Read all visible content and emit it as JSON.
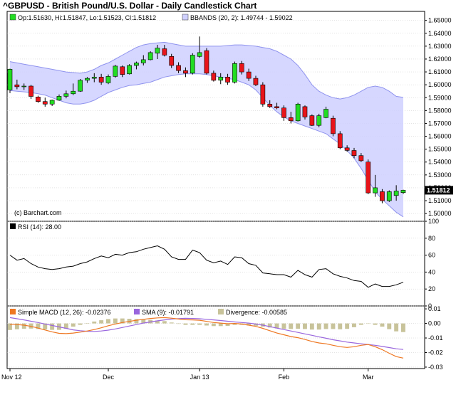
{
  "title": "^GBPUSD - British Pound/U.S. Dollar - Daily Candlestick Chart",
  "colors": {
    "up": "#22dd22",
    "down": "#e8141a",
    "band_fill": "#cfd0ff",
    "band_line": "#8f93ee",
    "rsi_line": "#000000",
    "macd_line": "#ee7722",
    "sma_line": "#9966dd",
    "divergence": "#c8c39a",
    "price_box": "#000000"
  },
  "chart_data": [
    {
      "type": "candlestick",
      "legend": [
        {
          "text": "Op:1.51630, Hi:1.51847, Lo:1.51523, Cl:1.51812",
          "color": "#22dd22"
        },
        {
          "text": "BBANDS (20, 2): 1.49744 - 1.59022",
          "color": "#cfd0ff"
        }
      ],
      "credit": "(c) Barchart.com",
      "last_price_label": "1.51812",
      "ylim": [
        1.494,
        1.657
      ],
      "yticks": [
        1.5,
        1.51,
        1.52,
        1.53,
        1.54,
        1.55,
        1.56,
        1.57,
        1.58,
        1.59,
        1.6,
        1.61,
        1.62,
        1.63,
        1.64,
        1.65
      ],
      "ytick_labels": [
        "1.50000",
        "1.51000",
        "1.52000",
        "1.53000",
        "1.54000",
        "1.55000",
        "1.56000",
        "1.57000",
        "1.58000",
        "1.59000",
        "1.60000",
        "1.61000",
        "1.62000",
        "1.63000",
        "1.64000",
        "1.65000"
      ],
      "x_labels": [
        {
          "text": "Nov 12",
          "index": 0
        },
        {
          "text": "Dec",
          "index": 14
        },
        {
          "text": "Jan 13",
          "index": 27
        },
        {
          "text": "Feb",
          "index": 39
        },
        {
          "text": "Mar",
          "index": 51
        }
      ],
      "candles": [
        {
          "o": 1.596,
          "h": 1.6125,
          "l": 1.5935,
          "c": 1.612
        },
        {
          "o": 1.6,
          "h": 1.604,
          "l": 1.5965,
          "c": 1.5985
        },
        {
          "o": 1.5985,
          "h": 1.601,
          "l": 1.596,
          "c": 1.599
        },
        {
          "o": 1.599,
          "h": 1.6,
          "l": 1.589,
          "c": 1.591
        },
        {
          "o": 1.5905,
          "h": 1.5915,
          "l": 1.586,
          "c": 1.587
        },
        {
          "o": 1.587,
          "h": 1.59,
          "l": 1.583,
          "c": 1.585
        },
        {
          "o": 1.585,
          "h": 1.5885,
          "l": 1.5835,
          "c": 1.588
        },
        {
          "o": 1.588,
          "h": 1.5925,
          "l": 1.5875,
          "c": 1.591
        },
        {
          "o": 1.591,
          "h": 1.5955,
          "l": 1.5895,
          "c": 1.593
        },
        {
          "o": 1.593,
          "h": 1.601,
          "l": 1.592,
          "c": 1.595
        },
        {
          "o": 1.595,
          "h": 1.6045,
          "l": 1.5945,
          "c": 1.6035
        },
        {
          "o": 1.6035,
          "h": 1.606,
          "l": 1.6015,
          "c": 1.605
        },
        {
          "o": 1.605,
          "h": 1.609,
          "l": 1.602,
          "c": 1.606
        },
        {
          "o": 1.606,
          "h": 1.6085,
          "l": 1.6,
          "c": 1.602
        },
        {
          "o": 1.6015,
          "h": 1.608,
          "l": 1.6005,
          "c": 1.6065
        },
        {
          "o": 1.6065,
          "h": 1.6155,
          "l": 1.6055,
          "c": 1.6145
        },
        {
          "o": 1.614,
          "h": 1.615,
          "l": 1.606,
          "c": 1.608
        },
        {
          "o": 1.6085,
          "h": 1.616,
          "l": 1.608,
          "c": 1.615
        },
        {
          "o": 1.615,
          "h": 1.618,
          "l": 1.612,
          "c": 1.617
        },
        {
          "o": 1.617,
          "h": 1.623,
          "l": 1.615,
          "c": 1.6195
        },
        {
          "o": 1.6195,
          "h": 1.626,
          "l": 1.619,
          "c": 1.625
        },
        {
          "o": 1.6245,
          "h": 1.631,
          "l": 1.62,
          "c": 1.6285
        },
        {
          "o": 1.628,
          "h": 1.631,
          "l": 1.622,
          "c": 1.623
        },
        {
          "o": 1.622,
          "h": 1.624,
          "l": 1.613,
          "c": 1.615
        },
        {
          "o": 1.615,
          "h": 1.6175,
          "l": 1.609,
          "c": 1.611
        },
        {
          "o": 1.611,
          "h": 1.6135,
          "l": 1.606,
          "c": 1.609
        },
        {
          "o": 1.609,
          "h": 1.6245,
          "l": 1.608,
          "c": 1.623
        },
        {
          "o": 1.622,
          "h": 1.6375,
          "l": 1.621,
          "c": 1.625
        },
        {
          "o": 1.6265,
          "h": 1.6285,
          "l": 1.608,
          "c": 1.609
        },
        {
          "o": 1.609,
          "h": 1.611,
          "l": 1.6025,
          "c": 1.6035
        },
        {
          "o": 1.6035,
          "h": 1.609,
          "l": 1.6005,
          "c": 1.606
        },
        {
          "o": 1.606,
          "h": 1.6085,
          "l": 1.6,
          "c": 1.602
        },
        {
          "o": 1.602,
          "h": 1.618,
          "l": 1.601,
          "c": 1.6165
        },
        {
          "o": 1.6165,
          "h": 1.6185,
          "l": 1.608,
          "c": 1.61
        },
        {
          "o": 1.61,
          "h": 1.6125,
          "l": 1.603,
          "c": 1.605
        },
        {
          "o": 1.605,
          "h": 1.607,
          "l": 1.599,
          "c": 1.6
        },
        {
          "o": 1.6,
          "h": 1.602,
          "l": 1.583,
          "c": 1.585
        },
        {
          "o": 1.585,
          "h": 1.588,
          "l": 1.582,
          "c": 1.583
        },
        {
          "o": 1.583,
          "h": 1.586,
          "l": 1.581,
          "c": 1.582
        },
        {
          "o": 1.582,
          "h": 1.584,
          "l": 1.572,
          "c": 1.5745
        },
        {
          "o": 1.5745,
          "h": 1.579,
          "l": 1.57,
          "c": 1.572
        },
        {
          "o": 1.572,
          "h": 1.586,
          "l": 1.5715,
          "c": 1.585
        },
        {
          "o": 1.583,
          "h": 1.584,
          "l": 1.573,
          "c": 1.575
        },
        {
          "o": 1.576,
          "h": 1.577,
          "l": 1.568,
          "c": 1.5685
        },
        {
          "o": 1.5685,
          "h": 1.5775,
          "l": 1.567,
          "c": 1.576
        },
        {
          "o": 1.5745,
          "h": 1.583,
          "l": 1.574,
          "c": 1.581
        },
        {
          "o": 1.574,
          "h": 1.576,
          "l": 1.56,
          "c": 1.562
        },
        {
          "o": 1.562,
          "h": 1.564,
          "l": 1.55,
          "c": 1.551
        },
        {
          "o": 1.551,
          "h": 1.553,
          "l": 1.548,
          "c": 1.549
        },
        {
          "o": 1.549,
          "h": 1.551,
          "l": 1.543,
          "c": 1.545
        },
        {
          "o": 1.545,
          "h": 1.547,
          "l": 1.54,
          "c": 1.541
        },
        {
          "o": 1.54,
          "h": 1.542,
          "l": 1.515,
          "c": 1.516
        },
        {
          "o": 1.516,
          "h": 1.53,
          "l": 1.513,
          "c": 1.52
        },
        {
          "o": 1.517,
          "h": 1.519,
          "l": 1.508,
          "c": 1.51
        },
        {
          "o": 1.51,
          "h": 1.518,
          "l": 1.509,
          "c": 1.517
        },
        {
          "o": 1.514,
          "h": 1.522,
          "l": 1.51,
          "c": 1.5175
        },
        {
          "o": 1.5163,
          "h": 1.5185,
          "l": 1.5152,
          "c": 1.5181
        }
      ],
      "bband_upper": [
        1.618,
        1.617,
        1.616,
        1.615,
        1.614,
        1.613,
        1.612,
        1.611,
        1.61,
        1.6095,
        1.609,
        1.61,
        1.612,
        1.615,
        1.617,
        1.62,
        1.623,
        1.626,
        1.629,
        1.631,
        1.632,
        1.6325,
        1.633,
        1.632,
        1.631,
        1.63,
        1.63,
        1.63,
        1.63,
        1.63,
        1.63,
        1.6305,
        1.631,
        1.631,
        1.6305,
        1.63,
        1.629,
        1.628,
        1.626,
        1.623,
        1.62,
        1.615,
        1.608,
        1.6,
        1.595,
        1.592,
        1.59,
        1.589,
        1.59,
        1.592,
        1.595,
        1.598,
        1.599,
        1.598,
        1.595,
        1.591,
        1.5902
      ],
      "bband_lower": [
        1.5955,
        1.595,
        1.5945,
        1.594,
        1.593,
        1.592,
        1.59,
        1.588,
        1.586,
        1.585,
        1.585,
        1.586,
        1.588,
        1.591,
        1.594,
        1.596,
        1.598,
        1.5995,
        1.6,
        1.601,
        1.602,
        1.604,
        1.606,
        1.607,
        1.608,
        1.6085,
        1.6085,
        1.6085,
        1.608,
        1.607,
        1.606,
        1.605,
        1.604,
        1.602,
        1.6,
        1.596,
        1.59,
        1.584,
        1.579,
        1.575,
        1.572,
        1.57,
        1.568,
        1.566,
        1.564,
        1.562,
        1.558,
        1.554,
        1.549,
        1.543,
        1.535,
        1.526,
        1.517,
        1.511,
        1.506,
        1.501,
        1.4974
      ]
    },
    {
      "type": "line",
      "legend": [
        {
          "text": "RSI (14): 28.00",
          "color": "#000000"
        }
      ],
      "ylim": [
        0,
        100
      ],
      "yticks": [
        0,
        20,
        40,
        60,
        80,
        100
      ],
      "ytick_labels": [
        "0",
        "20",
        "40",
        "60",
        "80",
        "100"
      ],
      "series": [
        {
          "name": "RSI (14)",
          "values": [
            60,
            54,
            56,
            50,
            46,
            44,
            43,
            44,
            46,
            47,
            50,
            52,
            56,
            59,
            57,
            61,
            60,
            63,
            64,
            67,
            69,
            71,
            67,
            58,
            55,
            55,
            66,
            63,
            54,
            51,
            53,
            49,
            58,
            57,
            50,
            48,
            39,
            38,
            37,
            37,
            34,
            42,
            37,
            34,
            43,
            44,
            38,
            35,
            33,
            30,
            29,
            22,
            26,
            23,
            23,
            25,
            28
          ]
        }
      ]
    },
    {
      "type": "bar",
      "legend": [
        {
          "text": "Simple MACD (12, 26): -0.02376",
          "color": "#ee7722"
        },
        {
          "text": "SMA (9): -0.01791",
          "color": "#9966dd"
        },
        {
          "text": "Divergence: -0.00585",
          "color": "#c8c39a"
        }
      ],
      "ylim": [
        -0.031,
        0.012
      ],
      "yticks": [
        -0.03,
        -0.02,
        -0.01,
        0.0,
        0.01
      ],
      "ytick_labels": [
        "-0.03",
        "-0.02",
        "-0.01",
        "0.00",
        "0.01"
      ],
      "series": [
        {
          "name": "Simple MACD (12, 26)",
          "values": [
            -0.0005,
            -0.0008,
            -0.0012,
            -0.002,
            -0.0032,
            -0.0045,
            -0.0058,
            -0.0068,
            -0.007,
            -0.0066,
            -0.006,
            -0.0052,
            -0.0042,
            -0.003,
            -0.0016,
            -0.0004,
            0.0006,
            0.0014,
            0.0022,
            0.0028,
            0.0034,
            0.0038,
            0.004,
            0.0036,
            0.003,
            0.0025,
            0.0024,
            0.0022,
            0.0014,
            0.0006,
            0.0002,
            -0.0002,
            0.0,
            -0.0004,
            -0.0012,
            -0.002,
            -0.0034,
            -0.005,
            -0.0066,
            -0.0078,
            -0.009,
            -0.0098,
            -0.011,
            -0.0124,
            -0.0134,
            -0.014,
            -0.015,
            -0.016,
            -0.0165,
            -0.016,
            -0.015,
            -0.0145,
            -0.016,
            -0.018,
            -0.0205,
            -0.0228,
            -0.0238
          ]
        },
        {
          "name": "SMA (9)",
          "values": [
            0.004,
            0.0032,
            0.0024,
            0.0015,
            0.0006,
            -0.0004,
            -0.0014,
            -0.0024,
            -0.0034,
            -0.0044,
            -0.005,
            -0.0054,
            -0.0055,
            -0.0052,
            -0.0046,
            -0.0038,
            -0.0028,
            -0.0018,
            -0.0008,
            0.0002,
            0.001,
            0.0018,
            0.0024,
            0.003,
            0.0033,
            0.0035,
            0.0034,
            0.0032,
            0.0028,
            0.0024,
            0.002,
            0.0015,
            0.001,
            0.0006,
            0.0002,
            -0.0004,
            -0.0012,
            -0.0022,
            -0.0032,
            -0.0042,
            -0.0052,
            -0.0062,
            -0.0072,
            -0.0082,
            -0.0092,
            -0.0102,
            -0.0112,
            -0.012,
            -0.0128,
            -0.0134,
            -0.014,
            -0.0145,
            -0.015,
            -0.0158,
            -0.0166,
            -0.0174,
            -0.0179
          ]
        },
        {
          "name": "Divergence",
          "values": [
            -0.0045,
            -0.004,
            -0.0036,
            -0.0035,
            -0.0038,
            -0.0041,
            -0.0044,
            -0.0044,
            -0.0036,
            -0.0022,
            -0.001,
            0.0002,
            0.0013,
            0.0022,
            0.003,
            0.0034,
            0.0034,
            0.0032,
            0.003,
            0.0026,
            0.0024,
            0.002,
            0.0016,
            0.0006,
            -0.0003,
            -0.001,
            -0.001,
            -0.001,
            -0.0014,
            -0.0018,
            -0.0018,
            -0.0017,
            -0.001,
            -0.001,
            -0.0014,
            -0.0016,
            -0.0022,
            -0.0028,
            -0.0034,
            -0.0036,
            -0.0038,
            -0.0036,
            -0.0038,
            -0.0042,
            -0.0042,
            -0.0038,
            -0.0038,
            -0.004,
            -0.0037,
            -0.0026,
            -0.001,
            0.0,
            -0.001,
            -0.0022,
            -0.0039,
            -0.0054,
            -0.0059
          ]
        }
      ]
    }
  ]
}
